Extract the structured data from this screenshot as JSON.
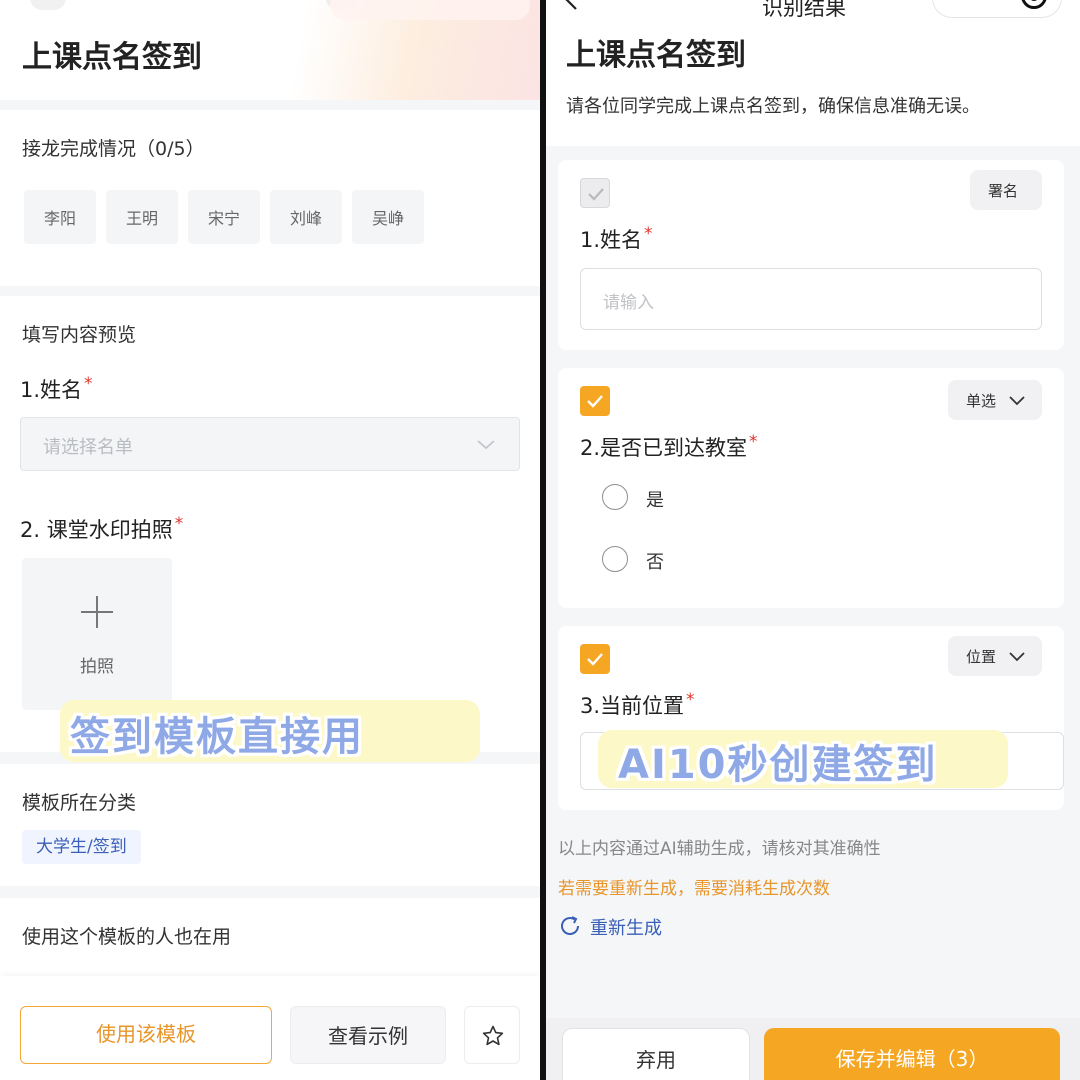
{
  "left": {
    "page_title": "上课点名签到",
    "progress": {
      "label": "接龙完成情况（0/5）",
      "names": [
        "李阳",
        "王明",
        "宋宁",
        "刘峰",
        "吴峥"
      ]
    },
    "preview": {
      "label": "填写内容预览",
      "q1": {
        "label": "1.姓名",
        "required": "*",
        "placeholder": "请选择名单"
      },
      "q2": {
        "label": "2. 课堂水印拍照",
        "required": "*",
        "photo_label": "拍照"
      }
    },
    "sticker": "签到模板直接用",
    "category": {
      "label": "模板所在分类",
      "tag": "大学生/签到"
    },
    "others": {
      "label": "使用这个模板的人也在用"
    },
    "buttons": {
      "use": "使用该模板",
      "example": "查看示例"
    }
  },
  "right": {
    "nav_title": "识别结果",
    "page_title": "上课点名签到",
    "description": "请各位同学完成上课点名签到，确保信息准确无误。",
    "q1": {
      "type": "署名",
      "label": "1.姓名",
      "required": "*",
      "placeholder": "请输入"
    },
    "q2": {
      "type": "单选",
      "label": "2.是否已到达教室",
      "required": "*",
      "options": [
        "是",
        "否"
      ]
    },
    "q3": {
      "type": "位置",
      "label": "3.当前位置",
      "required": "*"
    },
    "sticker": "AI10秒创建签到",
    "note_ai": "以上内容通过AI辅助生成，请核对其准确性",
    "note_cost": "若需要重新生成，需要消耗生成次数",
    "regenerate": "重新生成",
    "buttons": {
      "discard": "弃用",
      "save": "保存并编辑（3）"
    }
  },
  "colors": {
    "accent": "#f5a623",
    "link": "#3a5fb8",
    "required": "#e0342f"
  }
}
